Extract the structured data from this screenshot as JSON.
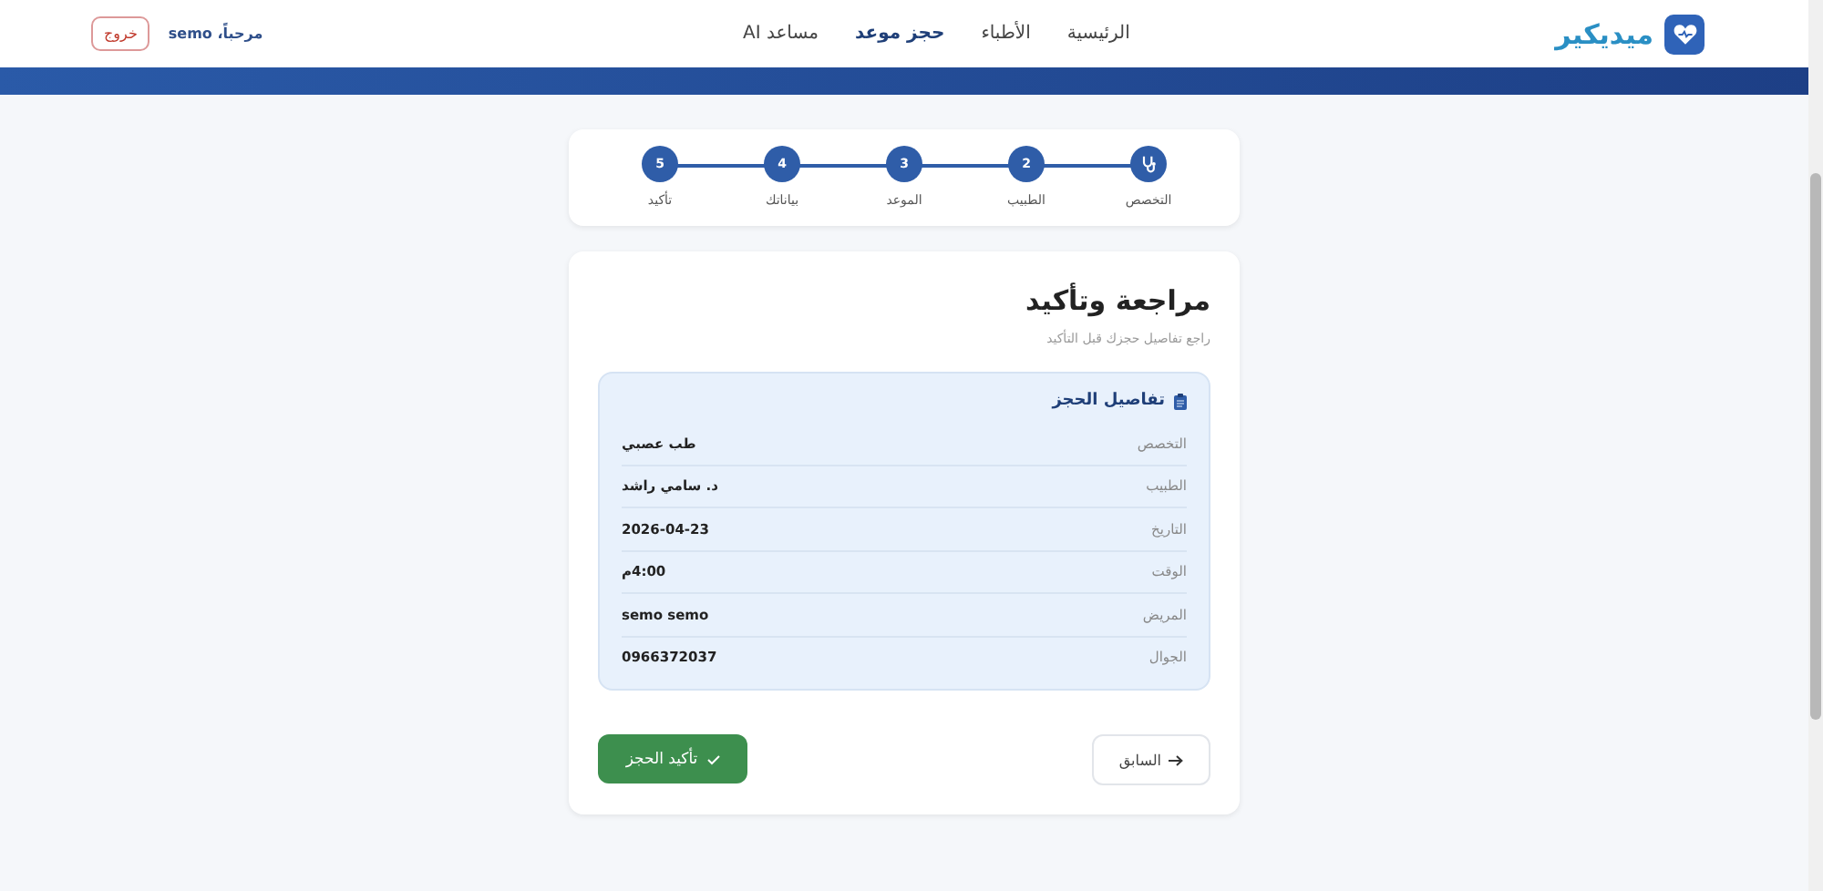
{
  "header": {
    "logo": "ميديكير",
    "nav": [
      {
        "label": "الرئيسية",
        "selected": false
      },
      {
        "label": "الأطباء",
        "selected": false
      },
      {
        "label": "حجز موعد",
        "selected": true
      },
      {
        "label": "مساعد AI",
        "selected": false
      }
    ],
    "greeting": "مرحباً، semo",
    "logout": "خروج"
  },
  "stepper": [
    {
      "kind": "icon",
      "label": "التخصص"
    },
    {
      "kind": "number",
      "number": "2",
      "label": "الطبيب"
    },
    {
      "kind": "number",
      "number": "3",
      "label": "الموعد"
    },
    {
      "kind": "number",
      "number": "4",
      "label": "بياناتك"
    },
    {
      "kind": "number",
      "number": "5",
      "label": "تأكيد"
    }
  ],
  "review": {
    "title": "مراجعة وتأكيد",
    "subtitle": "راجع تفاصيل حجزك قبل التأكيد",
    "details_title": "تفاصيل الحجز",
    "rows": [
      {
        "label": "التخصص",
        "value": "طب عصبي"
      },
      {
        "label": "الطبيب",
        "value": "د. سامي راشد"
      },
      {
        "label": "التاريخ",
        "value": "2026-04-23"
      },
      {
        "label": "الوقت",
        "value": "4:00م"
      },
      {
        "label": "المريض",
        "value": "semo semo"
      },
      {
        "label": "الجوال",
        "value": "0966372037"
      }
    ],
    "back": "السابق",
    "confirm": "تأكيد الحجز"
  }
}
